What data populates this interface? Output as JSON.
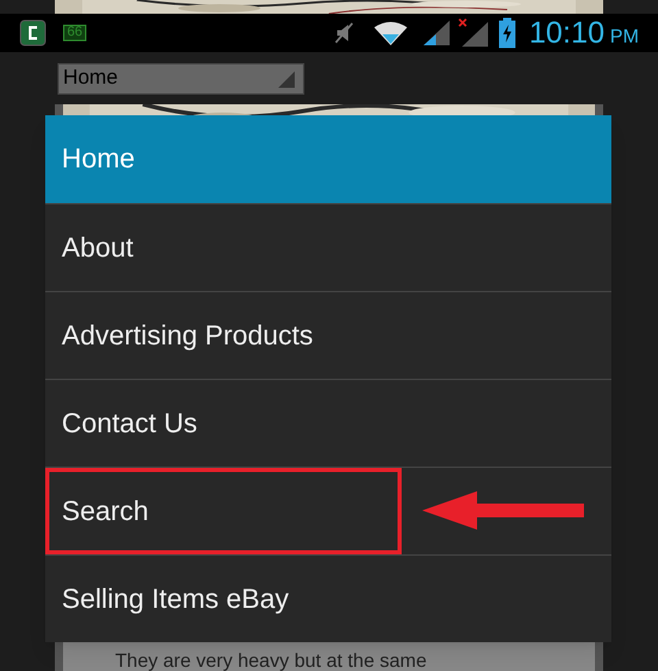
{
  "status_bar": {
    "notification": "66",
    "time": "10:10",
    "period": "PM"
  },
  "select": {
    "value": "Home"
  },
  "content": {
    "text": "They are very heavy but at the same"
  },
  "menu": {
    "items": [
      {
        "label": "Home",
        "selected": true,
        "highlighted": false
      },
      {
        "label": "About",
        "selected": false,
        "highlighted": false
      },
      {
        "label": "Advertising Products",
        "selected": false,
        "highlighted": false
      },
      {
        "label": "Contact Us",
        "selected": false,
        "highlighted": false
      },
      {
        "label": "Search",
        "selected": false,
        "highlighted": true
      },
      {
        "label": "Selling Items eBay",
        "selected": false,
        "highlighted": false
      }
    ]
  }
}
